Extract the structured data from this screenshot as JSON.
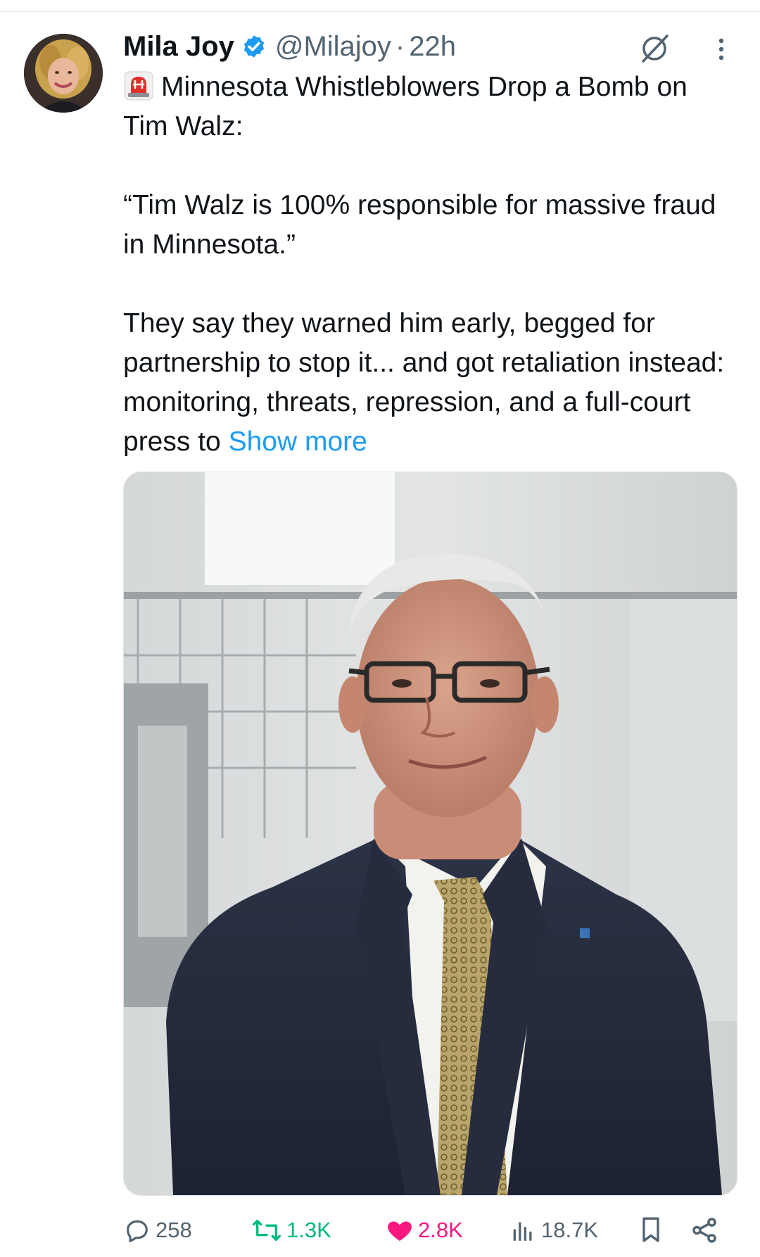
{
  "post": {
    "author": {
      "display_name": "Mila Joy",
      "handle": "@Milajoy",
      "separator": "·",
      "time": "22h",
      "verified": true,
      "avatar_icon": "profile-photo"
    },
    "text": {
      "line1_emoji": "rotating-light-icon",
      "line1": "Minnesota Whistleblowers Drop a Bomb on Tim Walz:",
      "quote": "“Tim Walz is 100% responsible for massive fraud in Minnesota.”",
      "body": "They say they warned him early, begged for partnership to stop it... and got retaliation instead: monitoring, threats, repression, and a full-court press to",
      "show_more": "Show more"
    },
    "media": {
      "type": "photo"
    },
    "actions": {
      "replies": "258",
      "reposts": "1.3K",
      "likes": "2.8K",
      "views": "18.7K"
    }
  },
  "colors": {
    "link": "#1d9bf0",
    "muted": "#536471",
    "repost": "#00ba7c",
    "like": "#f91880",
    "verified": "#1d9bf0"
  }
}
